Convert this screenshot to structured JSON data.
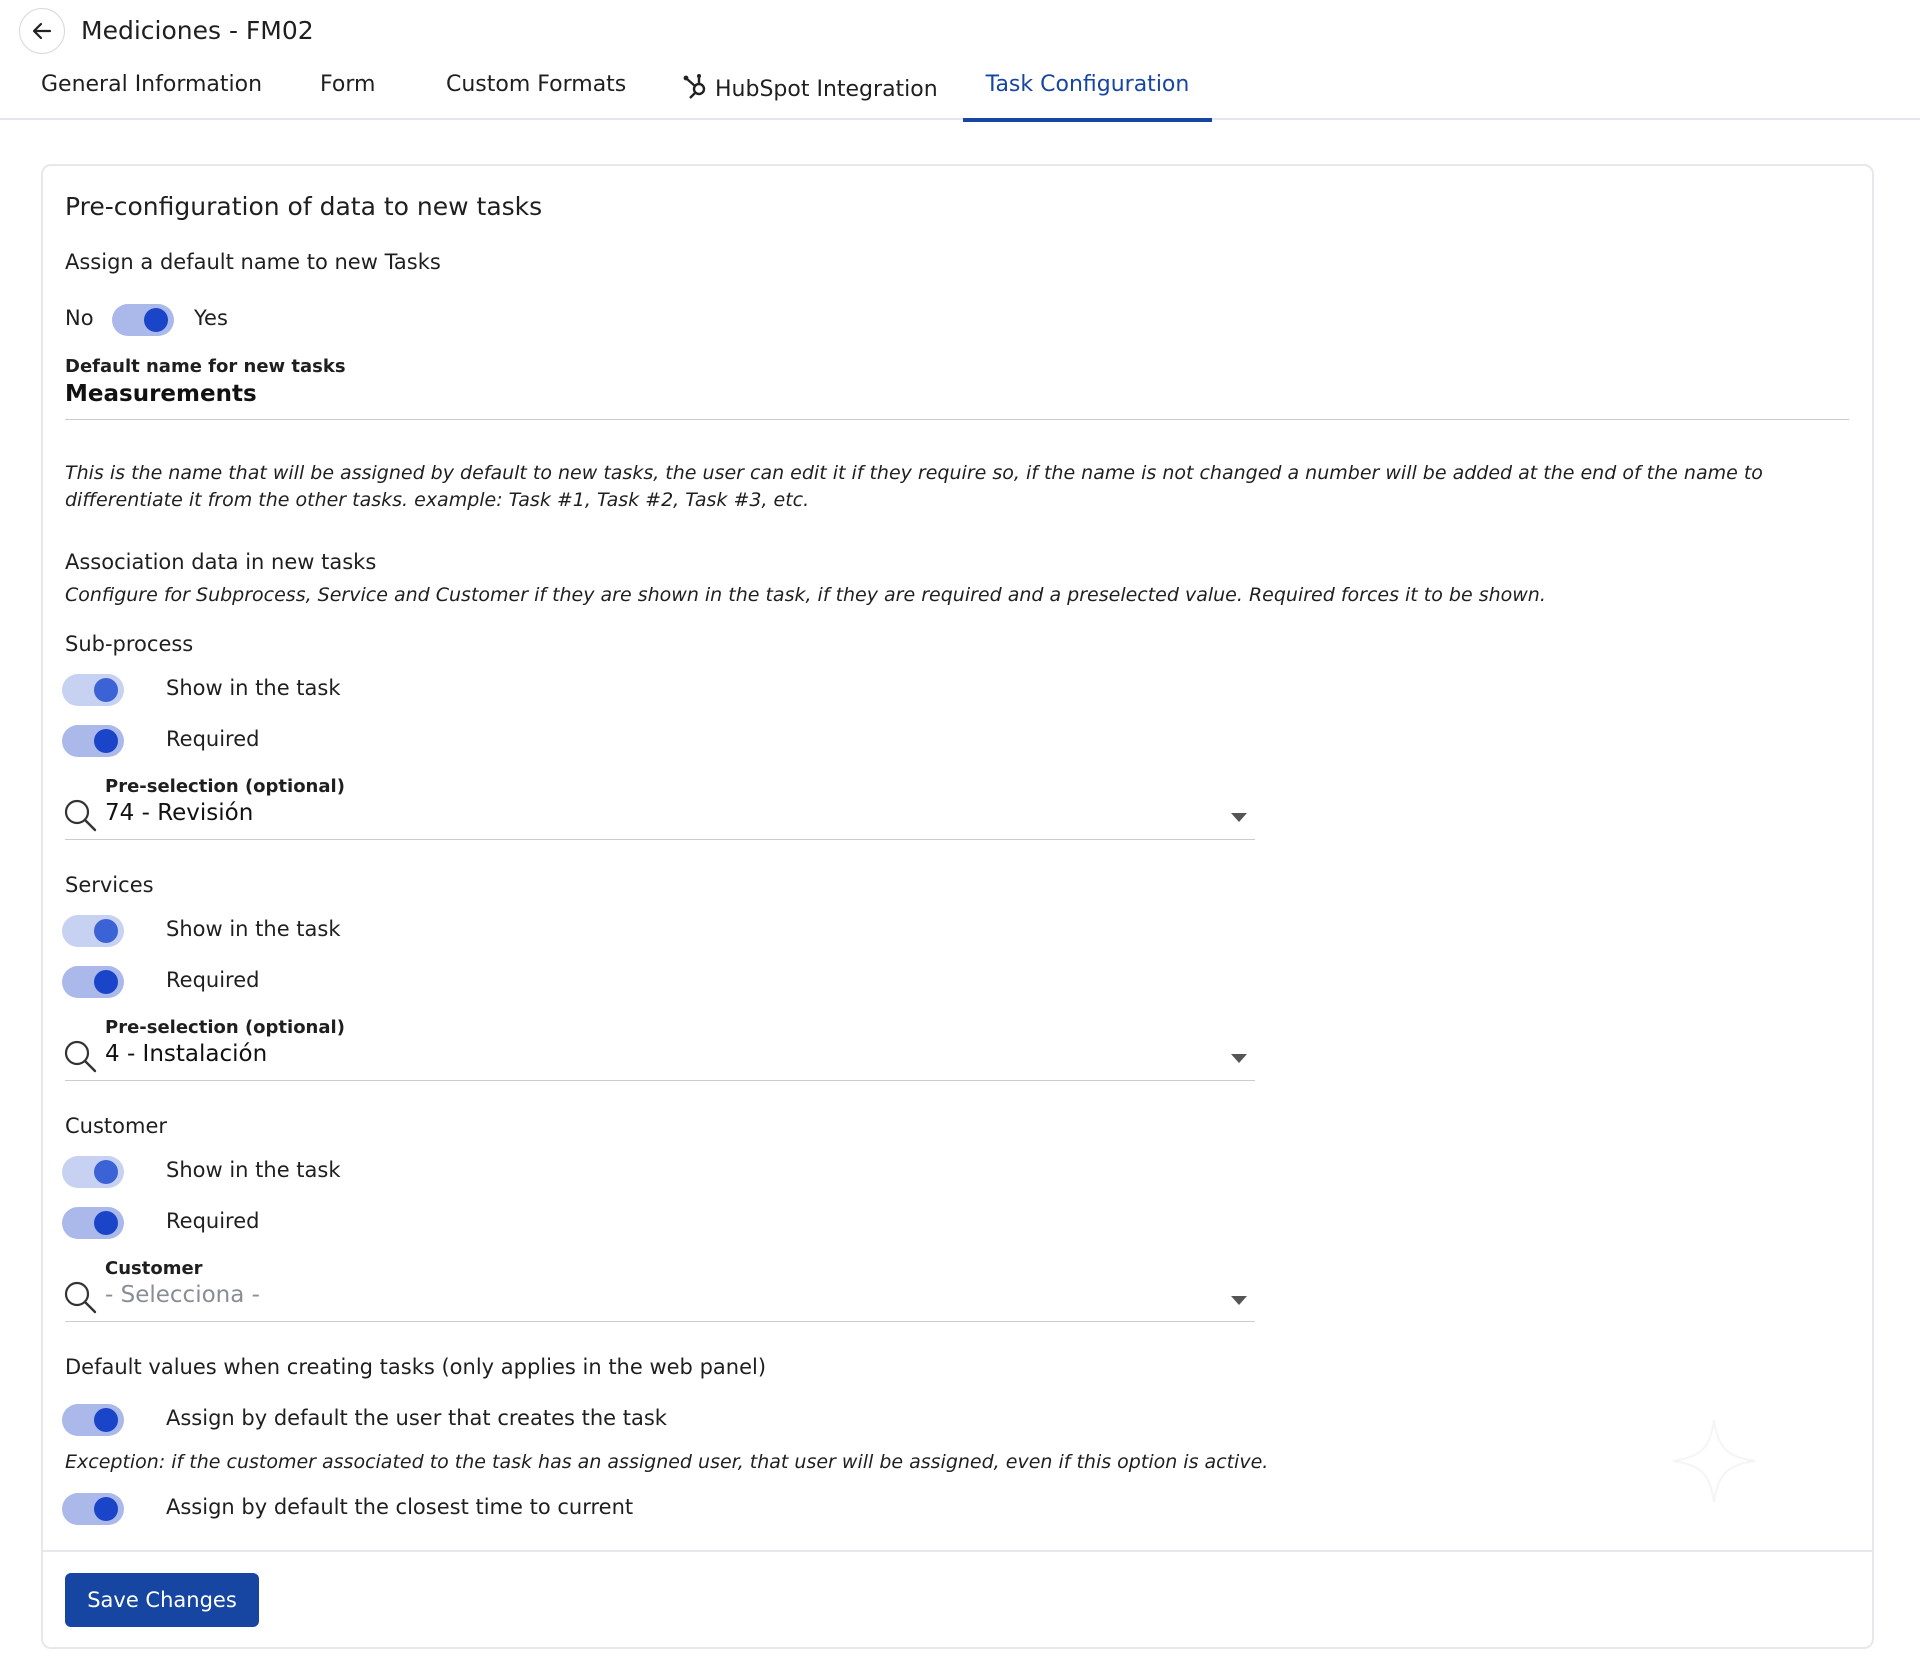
{
  "header": {
    "title": "Mediciones - FM02",
    "tabs": [
      {
        "label": "General Information"
      },
      {
        "label": "Form"
      },
      {
        "label": "Custom Formats"
      },
      {
        "label": "HubSpot Integration",
        "icon": "hubspot-icon"
      },
      {
        "label": "Task Configuration",
        "active": true
      }
    ]
  },
  "section": {
    "title": "Pre-configuration of data to new tasks",
    "default_name": {
      "question": "Assign a default name to new Tasks",
      "no_label": "No",
      "yes_label": "Yes",
      "enabled": true,
      "field_label": "Default name for new tasks",
      "field_value": "Measurements",
      "help_text": "This is the name that will be assigned by default to new tasks, the user can edit it if they require so, if the name is not changed a number will be added at the end of the name to differentiate it from the other tasks. example: Task #1, Task #2, Task #3, etc."
    },
    "association": {
      "title": "Association data in new tasks",
      "help_text": "Configure for Subprocess, Service and Customer if they are shown in the task, if they are required and a preselected value. Required forces it to be shown.",
      "groups": [
        {
          "title": "Sub-process",
          "show_label": "Show in the task",
          "show": true,
          "required_label": "Required",
          "required": true,
          "select_label": "Pre-selection (optional)",
          "select_value": "74 - Revisión"
        },
        {
          "title": "Services",
          "show_label": "Show in the task",
          "show": true,
          "required_label": "Required",
          "required": true,
          "select_label": "Pre-selection (optional)",
          "select_value": "4 - Instalación"
        },
        {
          "title": "Customer",
          "show_label": "Show in the task",
          "show": true,
          "required_label": "Required",
          "required": true,
          "select_label": "Customer",
          "select_placeholder": "- Selecciona -"
        }
      ]
    },
    "defaults": {
      "title": "Default values when creating tasks (only applies in the web panel)",
      "assign_user_label": "Assign by default the user that creates the task",
      "assign_user": true,
      "exception_text": "Exception: if the customer associated to the task has an assigned user, that user will be assigned, even if this option is active.",
      "closest_time_label": "Assign by default the closest time to current",
      "closest_time": true
    }
  },
  "footer": {
    "save_label": "Save Changes"
  },
  "colors": {
    "accent": "#1746a2",
    "toggle_track": "#aab8ea",
    "toggle_knob": "#1a45c9"
  }
}
